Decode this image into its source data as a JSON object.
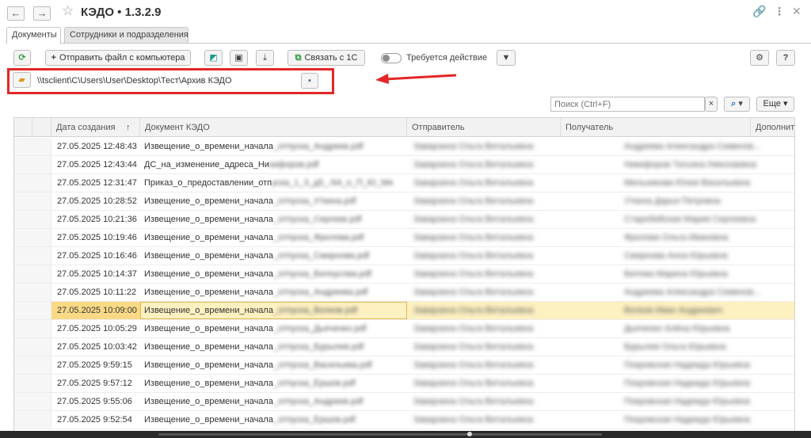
{
  "window": {
    "title": "КЭДО • 1.3.2.9"
  },
  "tabs": [
    {
      "label": "Документы",
      "active": true
    },
    {
      "label": "Сотрудники и подразделения",
      "active": false
    }
  ],
  "toolbar": {
    "send_file_label": "Отправить файл с компьютера",
    "link_1c_label": "Связать с 1С",
    "requires_action_label": "Требуется действие",
    "requires_action_on": false
  },
  "path_bar": {
    "path": "\\\\tsclient\\C\\Users\\User\\Desktop\\Тест\\Архив КЭДО"
  },
  "search": {
    "placeholder": "Поиск (Ctrl+F)",
    "more_label": "Еще"
  },
  "table": {
    "columns": [
      "Дата создания",
      "Документ КЭДО",
      "Отправитель",
      "Получатель",
      "Дополните"
    ],
    "rows": [
      {
        "date": "27.05.2025 12:48:43",
        "doc_visible": "Извещение_о_времени_начала",
        "doc_rest": "_отпуска_Андреев.pdf",
        "sender": "Заварзина Ольга Витальевна",
        "recipient": "Андреева Александра Семенов..."
      },
      {
        "date": "27.05.2025 12:43:44",
        "doc_visible": "ДС_на_изменение_адреса_Ни",
        "doc_rest": "кифоров.pdf",
        "sender": "Заварзина Ольга Витальевна",
        "recipient": "Никифоров Татьяна Николаевна"
      },
      {
        "date": "27.05.2025 12:31:47",
        "doc_visible": "Приказ_о_предоставлении_отп",
        "doc_rest": "уска_1_3_д5_.N4_о_П_Ю_Мя",
        "sender": "Заварзина Ольга Витальевна",
        "recipient": "Мельникова Юлия Васильевна"
      },
      {
        "date": "27.05.2025 10:28:52",
        "doc_visible": "Извещение_о_времени_начала",
        "doc_rest": "_отпуска_Уткина.pdf",
        "sender": "Заварзина Ольга Витальевна",
        "recipient": "Уткина Дарья Петровна"
      },
      {
        "date": "27.05.2025 10:21:36",
        "doc_visible": "Извещение_о_времени_начала",
        "doc_rest": "_отпуска_Сергеев.pdf",
        "sender": "Заварзина Ольга Витальевна",
        "recipient": "Старобейская Мария Сергеевна"
      },
      {
        "date": "27.05.2025 10:19:46",
        "doc_visible": "Извещение_о_времени_начала",
        "doc_rest": "_отпуска_Фролова.pdf",
        "sender": "Заварзина Ольга Витальевна",
        "recipient": "Фролова Ольга Ивановна"
      },
      {
        "date": "27.05.2025 10:16:46",
        "doc_visible": "Извещение_о_времени_начала",
        "doc_rest": "_отпуска_Смирнова.pdf",
        "sender": "Заварзина Ольга Витальевна",
        "recipient": "Смирнова Анна Юрьевна"
      },
      {
        "date": "27.05.2025 10:14:37",
        "doc_visible": "Извещение_о_времени_начала",
        "doc_rest": "_отпуска_Белоусова.pdf",
        "sender": "Заварзина Ольга Витальевна",
        "recipient": "Белова Марина Юрьевна"
      },
      {
        "date": "27.05.2025 10:11:22",
        "doc_visible": "Извещение_о_времени_начала",
        "doc_rest": "_отпуска_Андреева.pdf",
        "sender": "Заварзина Ольга Витальевна",
        "recipient": "Андреева Александра Семенов..."
      },
      {
        "date": "27.05.2025 10:09:00",
        "doc_visible": "Извещение_о_времени_начала",
        "doc_rest": "_отпуска_Волков.pdf",
        "sender": "Заварзина Ольга Витальевна",
        "recipient": "Волков Иван Андреевич",
        "selected": true
      },
      {
        "date": "27.05.2025 10:05:29",
        "doc_visible": "Извещение_о_времени_начала",
        "doc_rest": "_отпуска_Дьяченко.pdf",
        "sender": "Заварзина Ольга Витальевна",
        "recipient": "Дьяченко Алёна Юрьевна"
      },
      {
        "date": "27.05.2025 10:03:42",
        "doc_visible": "Извещение_о_времени_начала",
        "doc_rest": "_отпуска_Бурылев.pdf",
        "sender": "Заварзина Ольга Витальевна",
        "recipient": "Бурылев Ольга Юрьевна"
      },
      {
        "date": "27.05.2025 9:59:15",
        "doc_visible": "Извещение_о_времени_начала",
        "doc_rest": "_отпуска_Васильева.pdf",
        "sender": "Заварзина Ольга Витальевна",
        "recipient": "Покровская Надежда Юрьевна"
      },
      {
        "date": "27.05.2025 9:57:12",
        "doc_visible": "Извещение_о_времени_начала",
        "doc_rest": "_отпуска_Ершов.pdf",
        "sender": "Заварзина Ольга Витальевна",
        "recipient": "Покровская Надежда Юрьевна"
      },
      {
        "date": "27.05.2025 9:55:06",
        "doc_visible": "Извещение_о_времени_начала",
        "doc_rest": "_отпуска_Андреев.pdf",
        "sender": "Заварзина Ольга Витальевна",
        "recipient": "Покровская Надежда Юрьевна"
      },
      {
        "date": "27.05.2025 9:52:54",
        "doc_visible": "Извещение_о_времени_начала",
        "doc_rest": "_отпуска_Ершов.pdf",
        "sender": "Заварзина Ольга Витальевна",
        "recipient": "Покровская Надежда Юрьевна"
      }
    ]
  },
  "colors": {
    "highlight_box": "#e32626",
    "selected_row": "#fdf0c1",
    "selected_cell": "#f9d985",
    "refresh_icon": "#2f9b3a",
    "link_icon": "#2f9b3a"
  },
  "icons": [
    "back-arrow-icon",
    "forward-arrow-icon",
    "star-icon",
    "link-icon",
    "more-icon",
    "close-icon",
    "refresh-icon",
    "plus-icon",
    "chart-icon",
    "print-icon",
    "download-icon",
    "1c-link-icon",
    "filter-icon",
    "settings-icon",
    "help-icon",
    "folder-open-icon",
    "save-icon",
    "search-icon",
    "clear-icon",
    "sort-up-icon"
  ]
}
